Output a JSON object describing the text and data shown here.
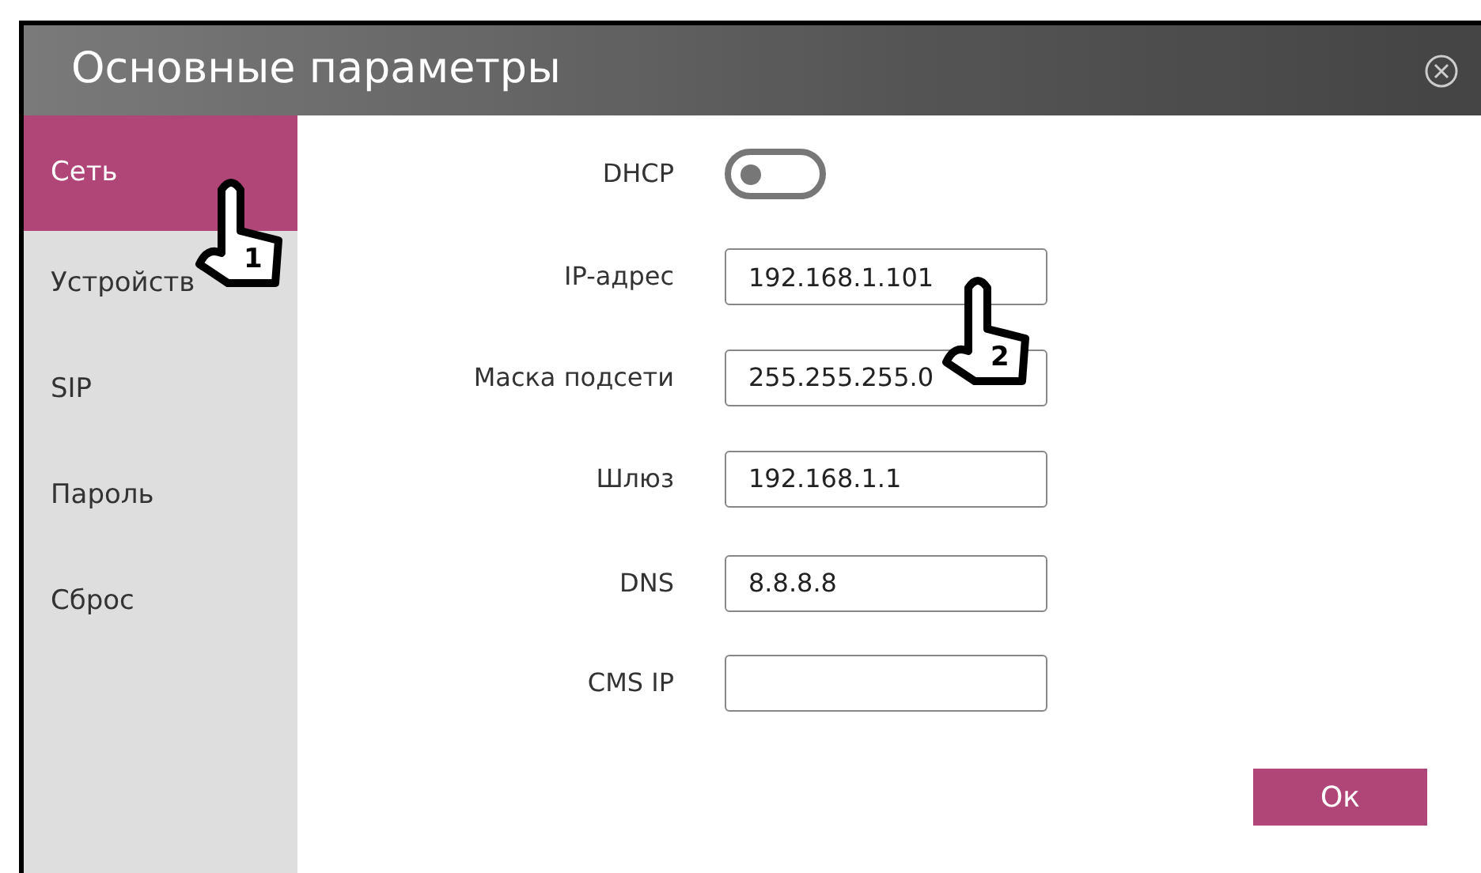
{
  "window": {
    "title": "Основные параметры"
  },
  "sidebar": {
    "items": [
      {
        "label": "Сеть",
        "selected": true
      },
      {
        "label": "Устройств",
        "selected": false
      },
      {
        "label": "SIP",
        "selected": false
      },
      {
        "label": "Пароль",
        "selected": false
      },
      {
        "label": "Сброс",
        "selected": false
      }
    ]
  },
  "form": {
    "rows": [
      {
        "kind": "toggle",
        "label": "DHCP",
        "on": false
      },
      {
        "kind": "field",
        "label": "IP-адрес",
        "value": "192.168.1.101"
      },
      {
        "kind": "field",
        "label": "Маска подсети",
        "value": "255.255.255.0"
      },
      {
        "kind": "field",
        "label": "Шлюз",
        "value": "192.168.1.1"
      },
      {
        "kind": "field",
        "label": "DNS",
        "value": "8.8.8.8"
      },
      {
        "kind": "field",
        "label": "CMS IP",
        "value": ""
      }
    ]
  },
  "ok_button": "Ок",
  "callouts": [
    {
      "number": "1"
    },
    {
      "number": "2"
    }
  ]
}
